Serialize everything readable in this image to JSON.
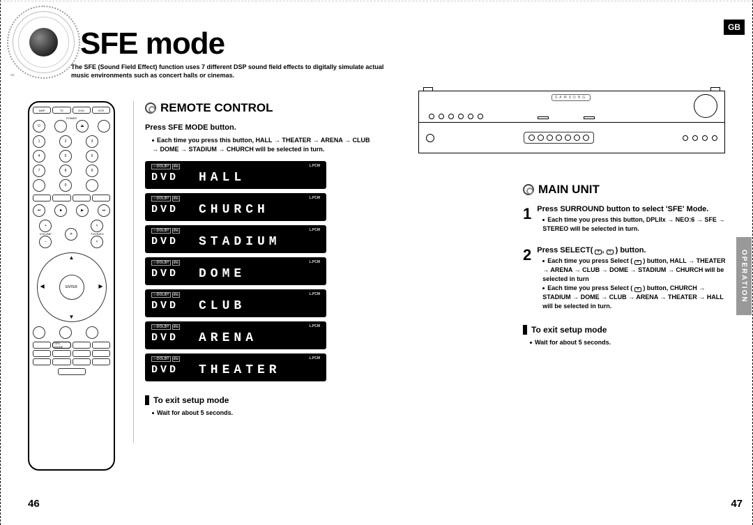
{
  "badge": "GB",
  "title": "SFE mode",
  "subtitle": "The SFE (Sound Field Effect) function uses 7 different DSP sound field effects to digitally simulate actual music environments such as concert halls or cinemas.",
  "sidetab": "OPERATION",
  "page_left": "46",
  "page_right": "47",
  "remote": {
    "heading": "REMOTE CONTROL",
    "instr_prefix": "Press ",
    "instr_key": "SFE MODE",
    "instr_suffix": " button.",
    "bullet_line": "Each time you press this button, HALL → THEATER → ARENA → CLUB → DOME → STADIUM → CHURCH will be selected in turn.",
    "lcd_prefix": "DVD",
    "lcd_icons_lpcm": "L.PCM",
    "displays": [
      {
        "text": "HALL"
      },
      {
        "text": "CHURCH"
      },
      {
        "text": "STADIUM"
      },
      {
        "text": "DOME"
      },
      {
        "text": "CLUB"
      },
      {
        "text": "ARENA"
      },
      {
        "text": "THEATER"
      }
    ],
    "exit_heading": "To exit setup mode",
    "exit_note": "Wait for about 5 seconds.",
    "buttons": {
      "top_row": [
        "AMP",
        "TV",
        "DVD",
        "VCR"
      ],
      "enter": "ENTER",
      "sfe_label": "SFE MODE"
    }
  },
  "main_unit": {
    "heading": "MAIN UNIT",
    "brand": "SAMSUNG",
    "step1": {
      "num": "1",
      "h_prefix": "Press ",
      "h_key": "SURROUND",
      "h_suffix": " button to select 'SFE' Mode.",
      "b": "Each time you press this button, DPLIIx → NEO:6 → SFE → STEREO will be selected in turn."
    },
    "step2": {
      "num": "2",
      "h_prefix": "Press ",
      "h_key": "SELECT",
      "h_mid": "( ",
      "h_down": "˅",
      "h_sep": ", ",
      "h_up": "˄",
      "h_suffix": " ) button.",
      "b1_prefix": "Each time you press Select ( ",
      "b1_icon": "˄",
      "b1_suffix": " ) button, HALL → THEATER → ARENA → CLUB → DOME → STADIUM → CHURCH will be selected in turn",
      "b2_prefix": "Each time you press Select ( ",
      "b2_icon": "˅",
      "b2_suffix": " ) button, CHURCH → STADIUM → DOME → CLUB → ARENA → THEATER → HALL will be selected in turn."
    },
    "exit_heading": "To exit setup mode",
    "exit_note": "Wait for about 5 seconds."
  }
}
